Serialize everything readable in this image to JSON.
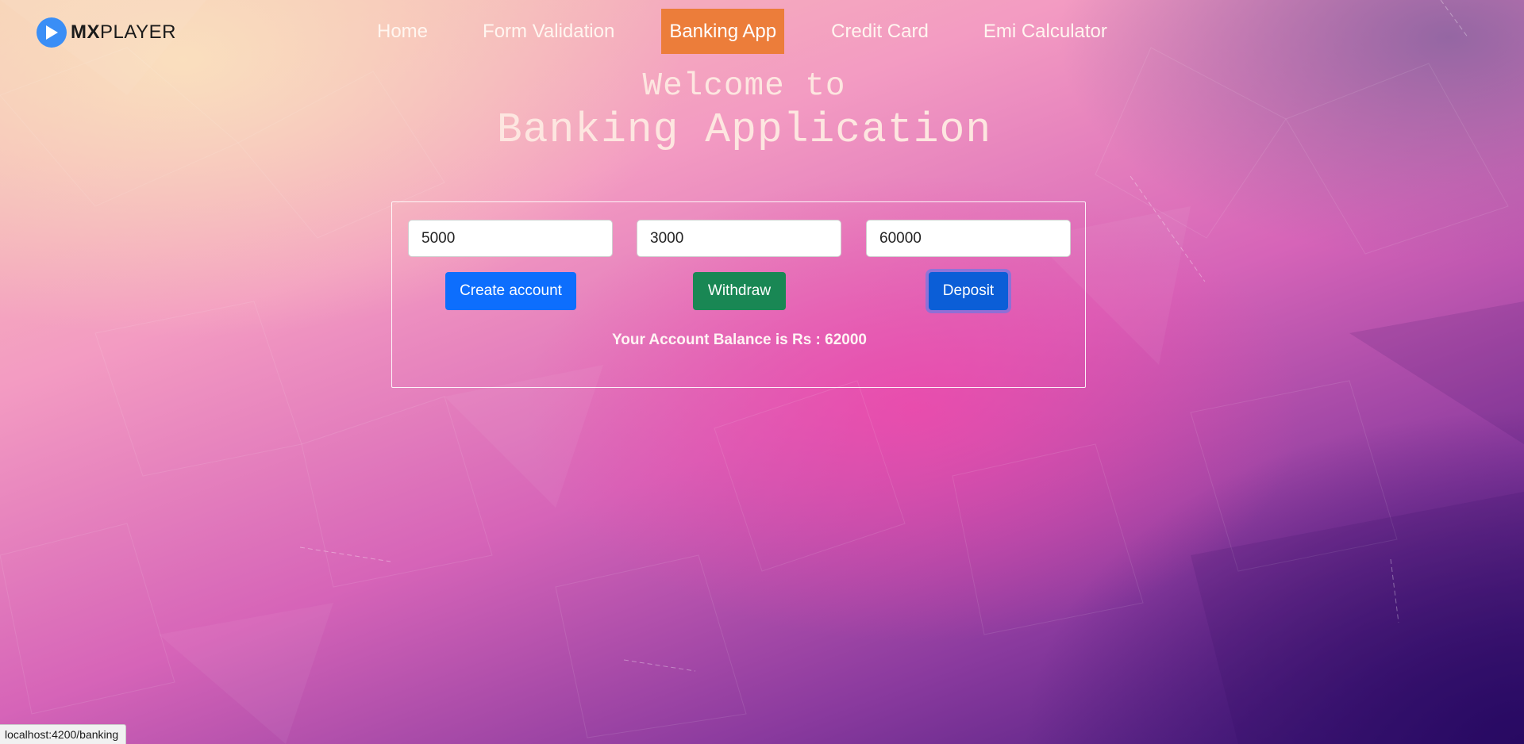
{
  "brand": {
    "name_bold": "MX",
    "name_rest": "PLAYER",
    "icon": "play-icon"
  },
  "nav": {
    "links": [
      {
        "label": "Home",
        "active": false
      },
      {
        "label": "Form Validation",
        "active": false
      },
      {
        "label": "Banking App",
        "active": true
      },
      {
        "label": "Credit Card",
        "active": false
      },
      {
        "label": "Emi Calculator",
        "active": false
      }
    ],
    "active_color": "#ec7d3a"
  },
  "heading": {
    "welcome": "Welcome to",
    "title": "Banking Application"
  },
  "banking": {
    "create_amount": "5000",
    "withdraw_amount": "3000",
    "deposit_amount": "60000",
    "create_label": "Create account",
    "withdraw_label": "Withdraw",
    "deposit_label": "Deposit",
    "balance_text": "Your Account Balance is Rs : 62000"
  },
  "status_bar": {
    "url": "localhost:4200/banking"
  },
  "colors": {
    "primary": "#0d6efd",
    "success": "#198754"
  }
}
